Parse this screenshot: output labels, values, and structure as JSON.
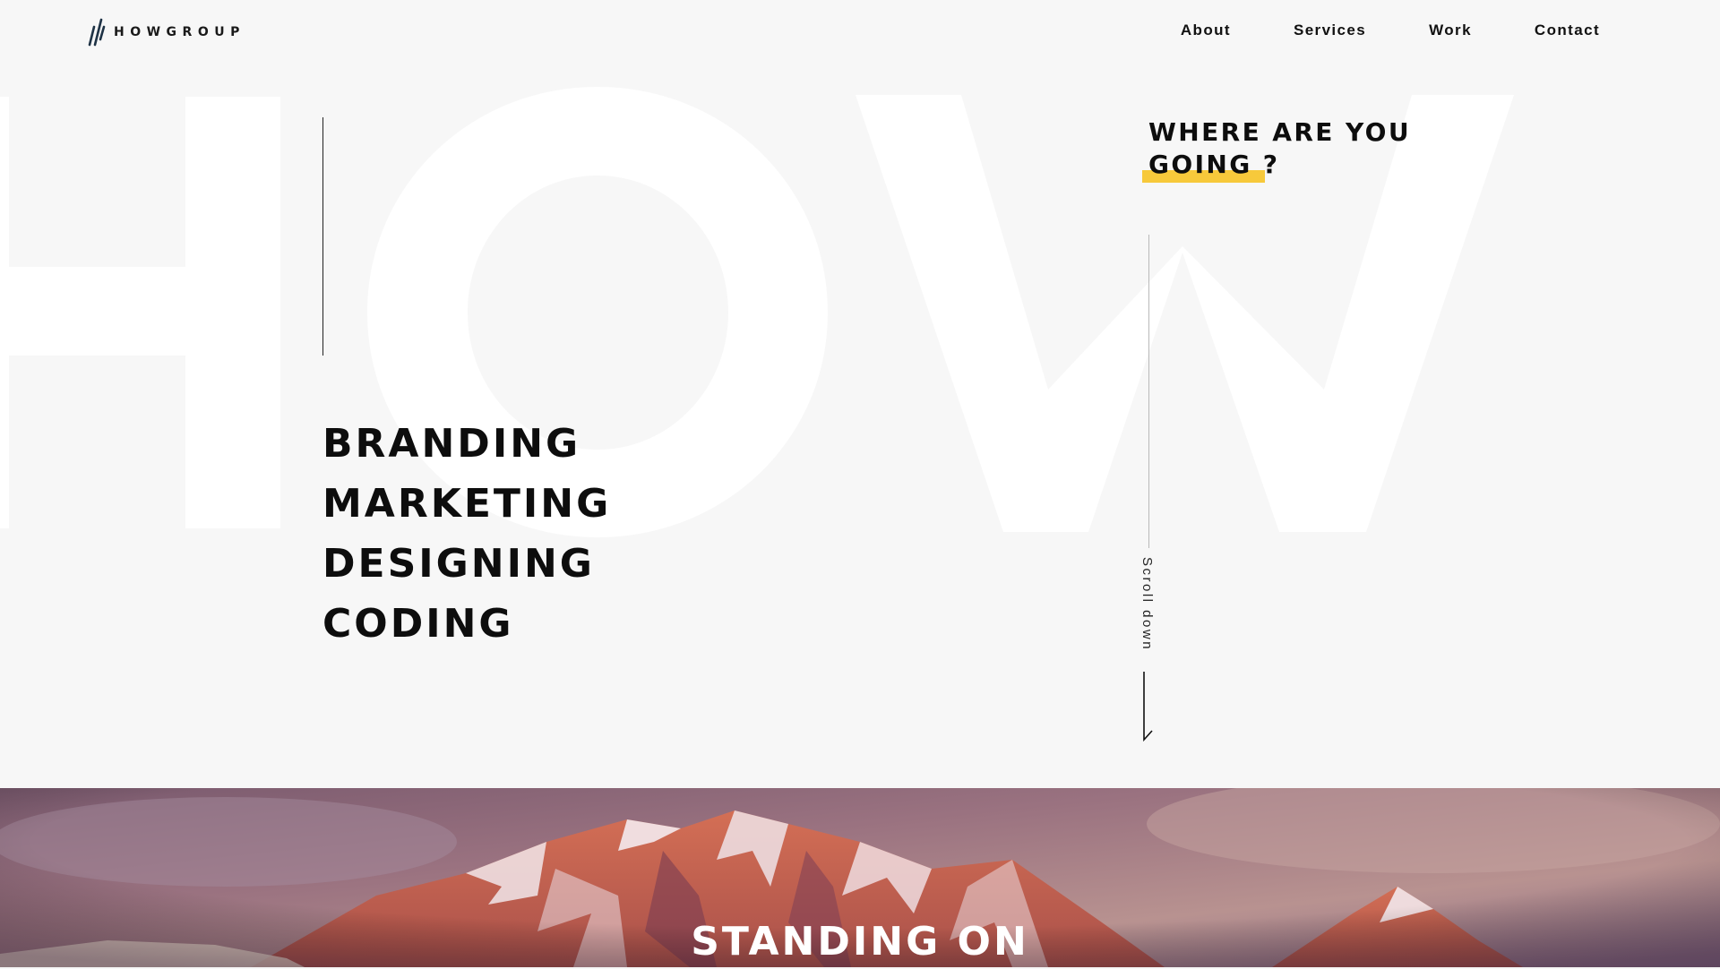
{
  "header": {
    "logo_text": "HOWGROUP",
    "nav": [
      {
        "label": "About"
      },
      {
        "label": "Services"
      },
      {
        "label": "Work"
      },
      {
        "label": "Contact"
      }
    ]
  },
  "background_text": "HOW",
  "services": [
    "BRANDING",
    "MARKETING",
    "DESIGNING",
    "CODING"
  ],
  "tagline": {
    "line1": "WHERE ARE YOU",
    "line2": "GOING ?"
  },
  "scroll": {
    "label": "Scroll down"
  },
  "hero": {
    "title": "STANDING ON"
  },
  "colors": {
    "background": "#f7f7f7",
    "text": "#111111",
    "highlight": "#f7c93b",
    "giant_letters": "#ffffff"
  },
  "icons": {
    "logo": "slash-mark-icon",
    "scroll": "arrow-down-icon"
  }
}
